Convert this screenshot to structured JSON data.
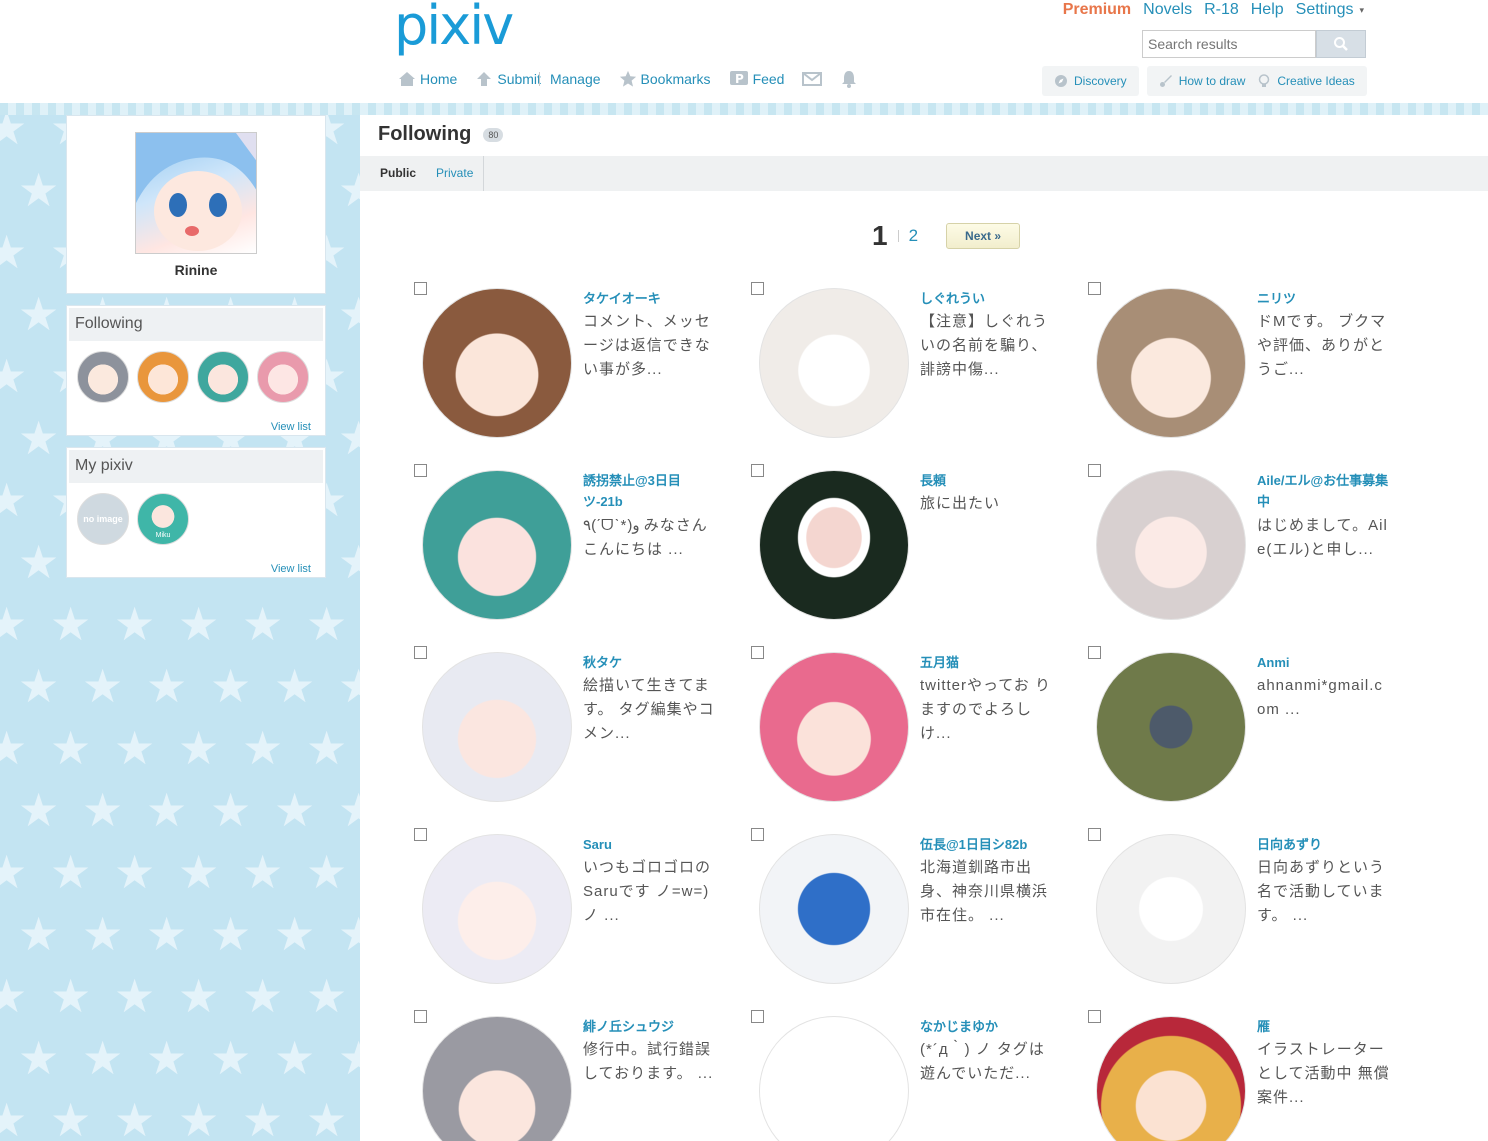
{
  "header": {
    "logo": "pixiv",
    "top_links": [
      {
        "label": "Premium",
        "type": "premium"
      },
      {
        "label": "Novels",
        "type": "link"
      },
      {
        "label": "R-18",
        "type": "link"
      },
      {
        "label": "Help",
        "type": "link"
      },
      {
        "label": "Settings",
        "type": "link"
      }
    ],
    "settings_caret": "▾",
    "search_placeholder": "Search results",
    "nav": {
      "home": "Home",
      "submit": "Submit",
      "manage": "Manage",
      "bookmarks": "Bookmarks",
      "feed": "Feed"
    },
    "right_nav": {
      "discovery": "Discovery",
      "how_to_draw": "How to draw",
      "creative_ideas": "Creative Ideas"
    }
  },
  "sidebar": {
    "profile_name": "Rinine",
    "following_title": "Following",
    "following_view_list": "View list",
    "mypixiv_title": "My pixiv",
    "mypixiv_view_list": "View list",
    "mypixiv_thumb1_text": "no image",
    "mypixiv_thumb2_text": "Miku"
  },
  "main": {
    "title": "Following",
    "count": "80",
    "tabs": {
      "public": "Public",
      "private": "Private"
    },
    "pager": {
      "current": "1",
      "page2": "2",
      "next": "Next »"
    },
    "users": [
      {
        "name": "タケイオーキ",
        "bio": "コメント、メッセージは返信できない事が多..."
      },
      {
        "name": "しぐれうい",
        "bio": "【注意】しぐれういの名前を騙り、誹謗中傷..."
      },
      {
        "name": "ニリツ",
        "bio": "ドMです。 ブクマや評価、ありがとうご..."
      },
      {
        "name": "誘拐禁止@3日目ツ-21b",
        "bio": "٩(ˊᗜˋ*)و みなさんこんにちは ..."
      },
      {
        "name": "長頼",
        "bio": "旅に出たい"
      },
      {
        "name": "Aile/エル@お仕事募集中",
        "bio": "はじめまして。Aile(エル)と申し..."
      },
      {
        "name": "秋タケ",
        "bio": "絵描いて生きてます。 タグ編集やコメン..."
      },
      {
        "name": "五月猫",
        "bio": "twitterやってお りますのでよろしけ..."
      },
      {
        "name": "Anmi",
        "bio": "ahnanmi*gmail.com ..."
      },
      {
        "name": "Saru",
        "bio": "いつもゴロゴロのSaruです ノ=w=) ノ ..."
      },
      {
        "name": "伍長@1日目シ82b",
        "bio": "北海道釧路市出身、神奈川県横浜市在住。 ..."
      },
      {
        "name": "日向あずり",
        "bio": "日向あずりという名で活動しています。 ..."
      },
      {
        "name": "緋ノ丘シュウジ",
        "bio": "修行中。試行錯誤しております。 ..."
      },
      {
        "name": "なかじまゆか",
        "bio": "(*´д｀) ノ タグは遊んでいただ..."
      },
      {
        "name": "雁",
        "bio": "イラストレーターとして活動中 無償案件..."
      }
    ]
  }
}
